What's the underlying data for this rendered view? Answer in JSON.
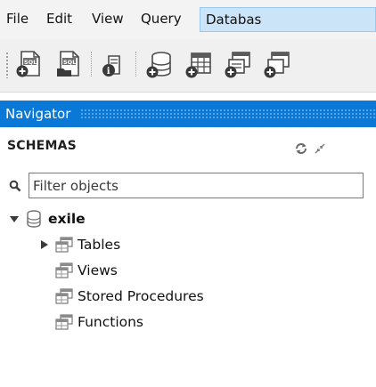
{
  "menubar": {
    "items": [
      {
        "label": "File"
      },
      {
        "label": "Edit"
      },
      {
        "label": "View"
      },
      {
        "label": "Query"
      },
      {
        "label": "Databas"
      }
    ],
    "active_index": 4
  },
  "toolbar": {
    "buttons": [
      {
        "icon": "new-sql-tab-icon"
      },
      {
        "icon": "open-sql-script-icon"
      },
      {
        "icon": "schema-inspector-icon"
      },
      {
        "icon": "create-schema-icon"
      },
      {
        "icon": "create-table-icon"
      },
      {
        "icon": "create-view-icon"
      },
      {
        "icon": "create-procedure-icon"
      }
    ]
  },
  "navigator": {
    "title": "Navigator"
  },
  "schemas": {
    "label": "SCHEMAS",
    "filter": {
      "placeholder": "Filter objects",
      "value": ""
    },
    "tree": {
      "schema": {
        "name": "exile",
        "expanded": true,
        "icon": "database-icon"
      },
      "children": [
        {
          "label": "Tables",
          "expandable": true,
          "icon": "folder-icon"
        },
        {
          "label": "Views",
          "expandable": false,
          "icon": "folder-icon"
        },
        {
          "label": "Stored Procedures",
          "expandable": false,
          "icon": "folder-icon"
        },
        {
          "label": "Functions",
          "expandable": false,
          "icon": "folder-icon"
        }
      ]
    }
  },
  "colors": {
    "navigator_header": "#0a78d7",
    "menu_active_bg": "#cce4f7",
    "menu_active_border": "#99c9ef"
  }
}
